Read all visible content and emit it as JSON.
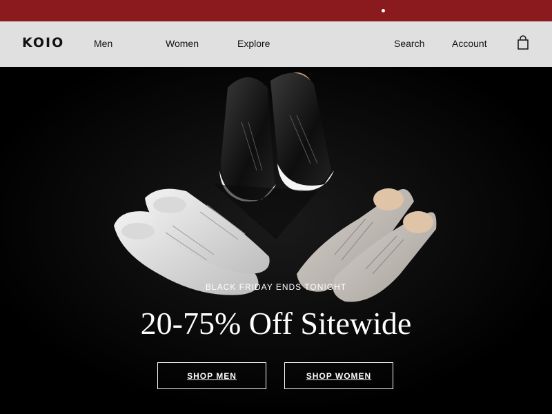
{
  "colors": {
    "announce_bar": "#8b1a1e",
    "nav_bg": "#e0e0e0",
    "hero_bg": "#000000"
  },
  "brand": {
    "logo": "KOIO"
  },
  "nav": {
    "men": "Men",
    "women": "Women",
    "explore": "Explore",
    "search": "Search",
    "account": "Account",
    "bag_icon": "shopping-bag-icon"
  },
  "hero": {
    "eyebrow": "Black Friday Ends Tonight",
    "headline": "20-75% Off Sitewide",
    "shop_men": "SHOP MEN",
    "shop_women": "SHOP WOMEN"
  }
}
